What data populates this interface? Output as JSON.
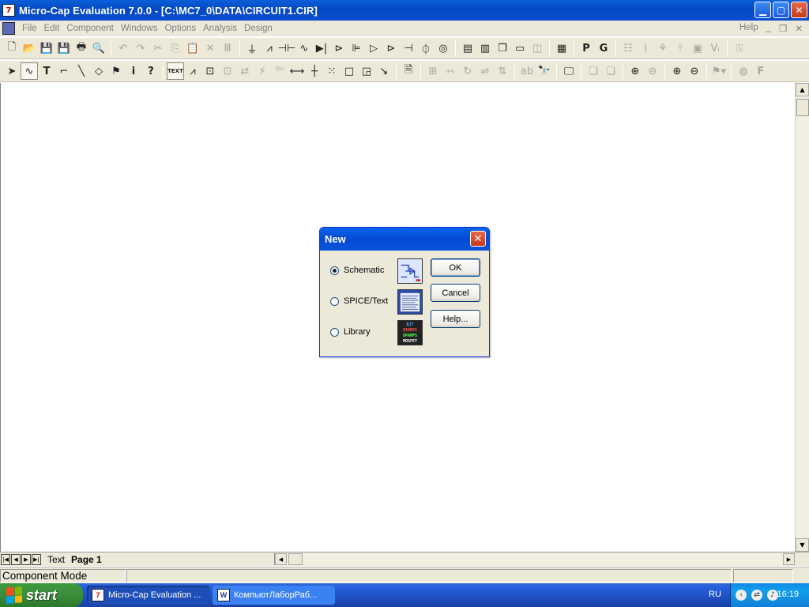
{
  "window": {
    "title": "Micro-Cap Evaluation 7.0.0 - [C:\\MC7_0\\DATA\\CIRCUIT1.CIR]",
    "app_icon": "7"
  },
  "menu": {
    "items": [
      "File",
      "Edit",
      "Component",
      "Windows",
      "Options",
      "Analysis",
      "Design"
    ],
    "help": "Help"
  },
  "dialog": {
    "title": "New",
    "options": [
      {
        "label": "Schematic",
        "selected": true
      },
      {
        "label": "SPICE/Text",
        "selected": false
      },
      {
        "label": "Library",
        "selected": false
      }
    ],
    "buttons": {
      "ok": "OK",
      "cancel": "Cancel",
      "help": "Help..."
    },
    "library_thumb_lines": [
      "BJT",
      "DIODES",
      "OPAMPS",
      "MOSFET"
    ]
  },
  "tabs": {
    "text": "Text",
    "page": "Page 1"
  },
  "status": {
    "mode": "Component Mode"
  },
  "taskbar": {
    "start": "start",
    "tasks": [
      "Micro-Cap Evaluation ...",
      "КомпьютЛаборРаб..."
    ],
    "lang": "RU",
    "clock": "16:19"
  },
  "toolbar2": {
    "text_button": "TEXT"
  },
  "colors": {
    "xp_blue": "#0347c4",
    "start_green": "#3c8c3c",
    "xp_close_red": "#c53a17",
    "face": "#ece9d8"
  }
}
